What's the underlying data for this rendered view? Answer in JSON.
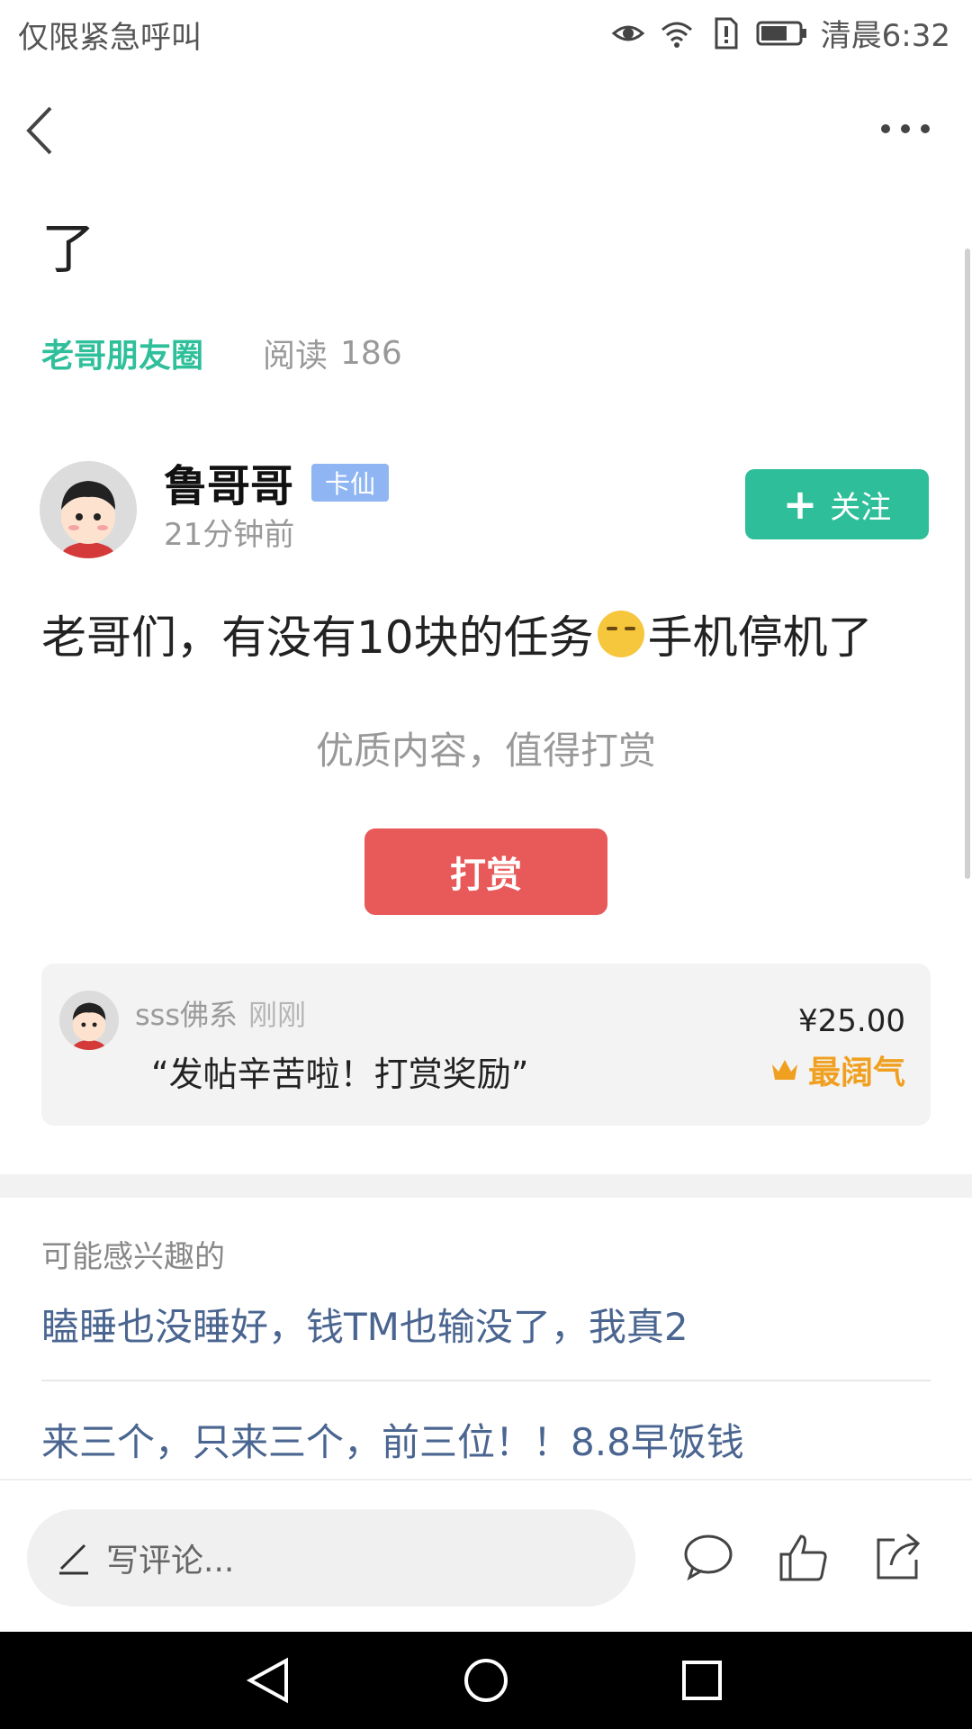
{
  "status_bar": {
    "carrier": "仅限紧急呼叫",
    "time": "清晨6:32",
    "icons": [
      "eye-icon",
      "wifi-icon",
      "sim-alert-icon",
      "battery-icon"
    ]
  },
  "nav": {
    "back_icon": "chevron-left-icon",
    "more_icon": "more-horizontal-icon"
  },
  "post": {
    "title": "了",
    "category": "老哥朋友圈",
    "read_label": "阅读",
    "read_count": "186",
    "author": {
      "name": "鲁哥哥",
      "badge": "卡仙",
      "time": "21分钟前"
    },
    "follow_label": "关注",
    "body_before_emoji": "老哥们，有没有10块的任务",
    "emoji": "sweat-smile-emoji",
    "body_after_emoji": "手机停机了",
    "reward_hint": "优质内容，值得打赏",
    "reward_button": "打赏"
  },
  "reward_record": {
    "user": "sss佛系",
    "time": "刚刚",
    "message": "“发帖辛苦啦！打赏奖励”",
    "amount": "¥25.00",
    "tag": "最阔气",
    "tag_icon": "crown-icon"
  },
  "recommend": {
    "section_label": "可能感兴趣的",
    "items": [
      "瞌睡也没睡好，钱TM也输没了，我真2",
      "来三个，只来三个，前三位！！8.8早饭钱"
    ]
  },
  "comment_bar": {
    "placeholder": "写评论...",
    "icons": [
      "pen-icon",
      "comment-icon",
      "like-icon",
      "share-icon"
    ]
  },
  "colors": {
    "accent_green": "#2ebe99",
    "reward_red": "#e8595a",
    "badge_blue": "#8fb5f2",
    "link_blue": "#4a6590",
    "gold": "#f0a020"
  }
}
